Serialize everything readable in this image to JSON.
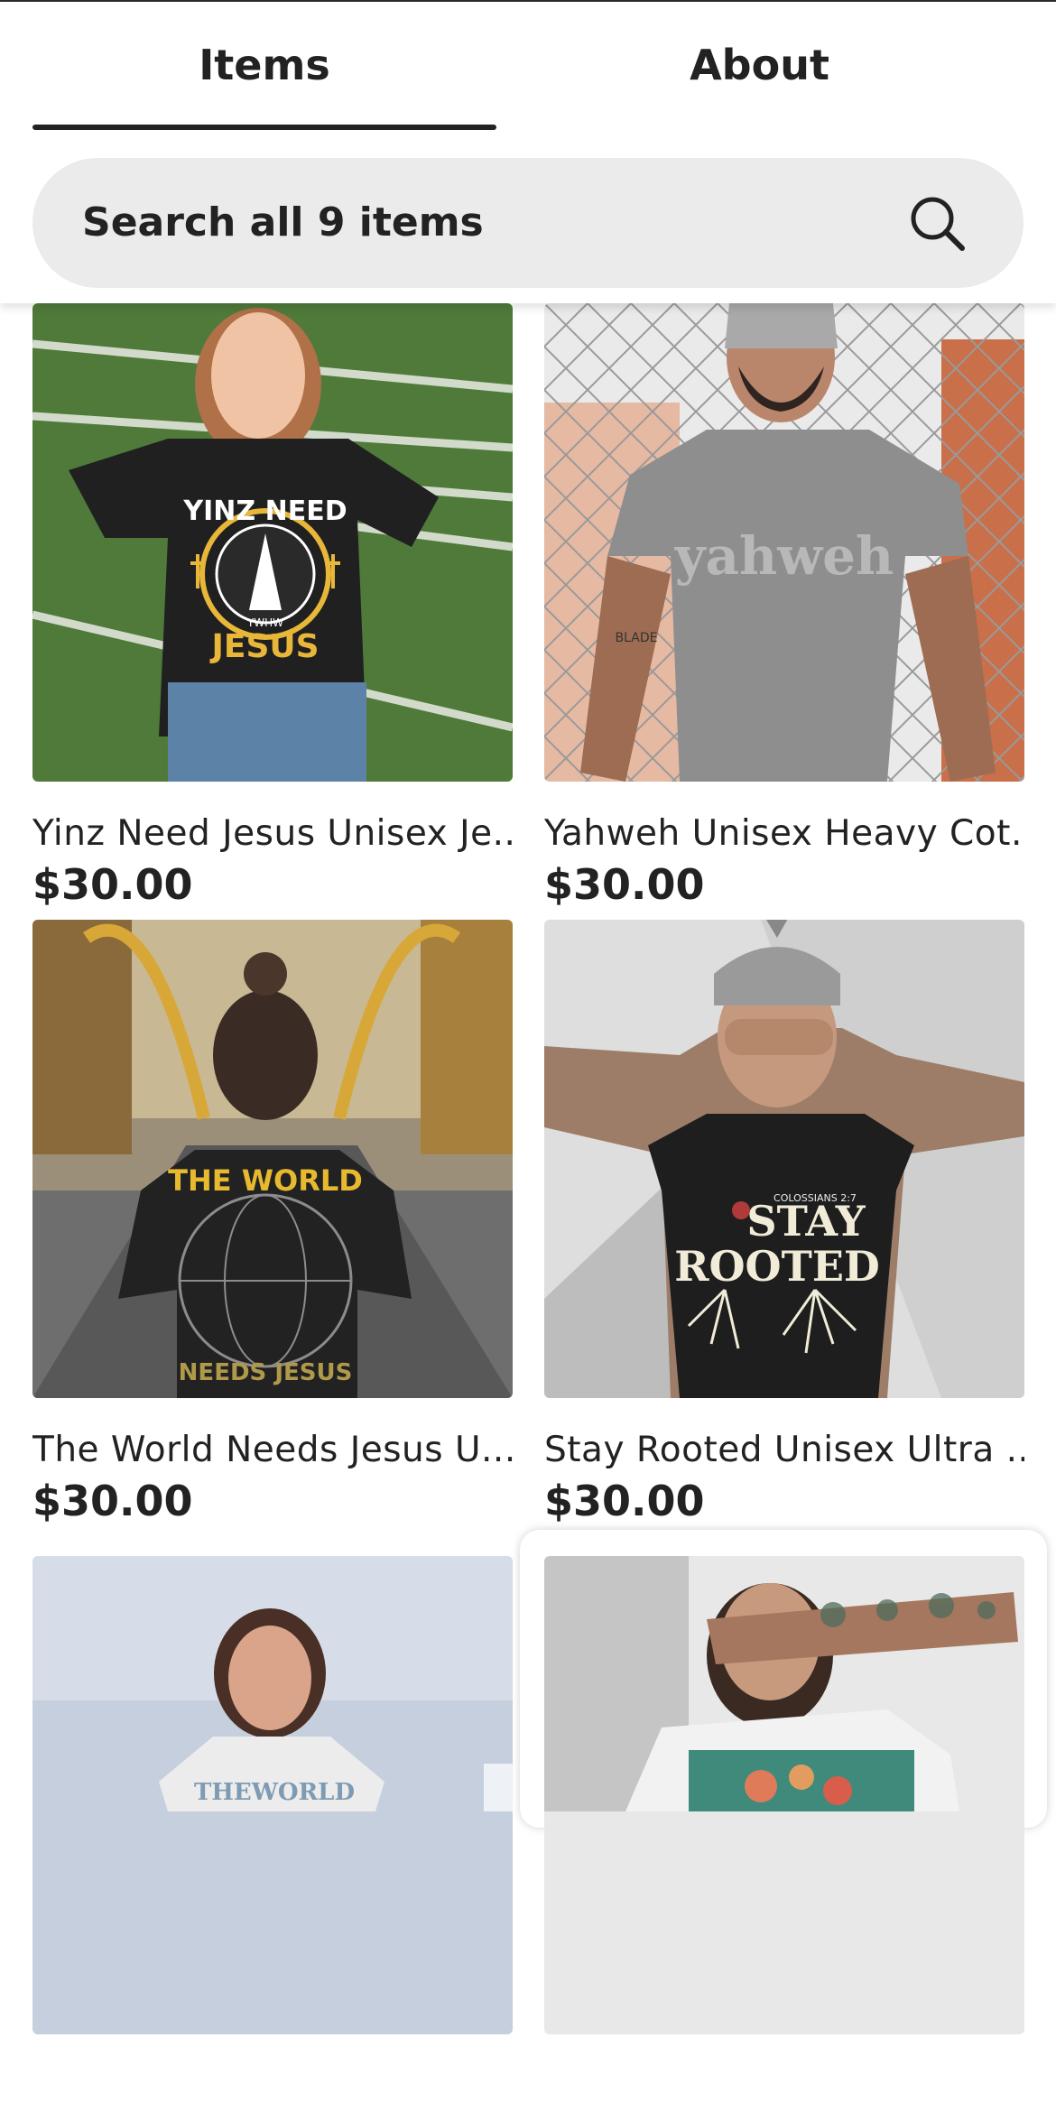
{
  "tabs": [
    {
      "label": "Items",
      "active": true
    },
    {
      "label": "About",
      "active": false
    }
  ],
  "search": {
    "placeholder": "Search all 9 items"
  },
  "products": [
    {
      "title": "Yinz Need Jesus Unisex Je...",
      "price": "$30.00",
      "image": {
        "shirt_text_top": "YINZ NEED",
        "shirt_text_small": "YWHW",
        "shirt_text_bottom": "JESUS"
      }
    },
    {
      "title": "Yahweh Unisex Heavy Cot...",
      "price": "$30.00",
      "image": {
        "shirt_text": "yahweh",
        "tattoo_text": "BLADE"
      }
    },
    {
      "title": "The World Needs Jesus U...",
      "price": "$30.00",
      "image": {
        "shirt_text_top": "THE WORLD",
        "shirt_text_bottom": "NEEDS JESUS"
      }
    },
    {
      "title": "Stay Rooted Unisex Ultra ...",
      "price": "$30.00",
      "image": {
        "shirt_text_small": "COLOSSIANS 2:7",
        "shirt_text_line1": "STAY",
        "shirt_text_line2": "ROOTED"
      }
    },
    {
      "title": "",
      "price": "",
      "image": {
        "shirt_text": "THEWORLD"
      }
    },
    {
      "title": "",
      "price": "",
      "image": {}
    }
  ],
  "colors": {
    "text": "#222222",
    "search_bg": "#ebebeb",
    "tab_indicator": "#222222"
  }
}
